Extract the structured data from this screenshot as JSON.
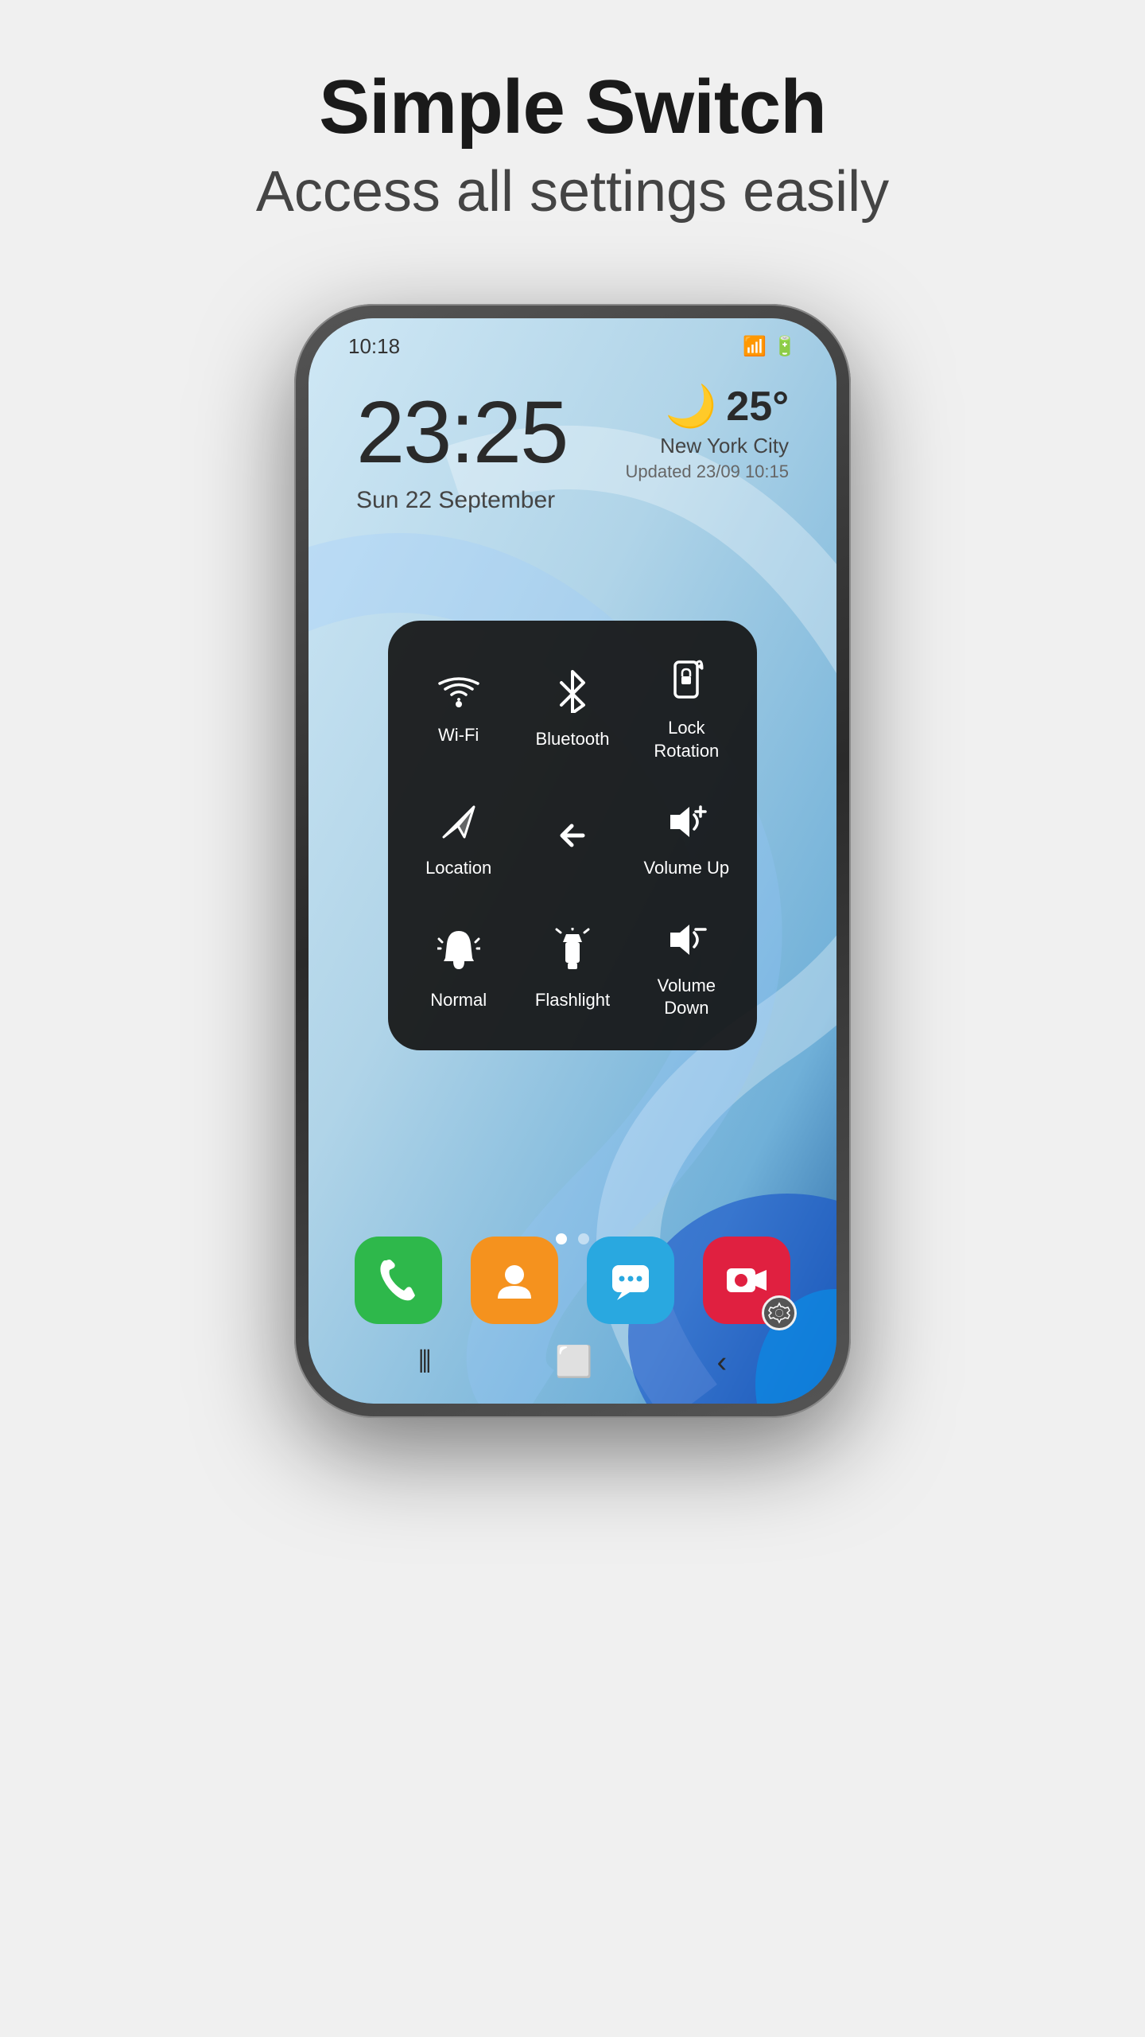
{
  "header": {
    "title": "Simple Switch",
    "subtitle": "Access all settings easily"
  },
  "phone": {
    "status_time": "10:18",
    "main_clock": "23:25",
    "main_date": "Sun 22 September",
    "weather": {
      "temp": "25°",
      "city": "New York City",
      "updated": "Updated 23/09 10:15",
      "moon_icon": "🌙"
    },
    "quick_controls": [
      {
        "id": "wifi",
        "label": "Wi-Fi",
        "icon": "wifi"
      },
      {
        "id": "bluetooth",
        "label": "Bluetooth",
        "icon": "bluetooth"
      },
      {
        "id": "lock-rotation",
        "label": "Lock\nRotation",
        "icon": "lock-rotation"
      },
      {
        "id": "location",
        "label": "Location",
        "icon": "location"
      },
      {
        "id": "back-arrow",
        "label": "",
        "icon": "back-arrow"
      },
      {
        "id": "volume-up",
        "label": "Volume Up",
        "icon": "volume-up"
      },
      {
        "id": "normal",
        "label": "Normal",
        "icon": "normal-bell"
      },
      {
        "id": "flashlight",
        "label": "Flashlight",
        "icon": "flashlight"
      },
      {
        "id": "volume-down",
        "label": "Volume\nDown",
        "icon": "volume-down"
      }
    ],
    "dock_apps": [
      {
        "id": "phone",
        "label": "Phone",
        "type": "phone"
      },
      {
        "id": "contacts",
        "label": "Contacts",
        "type": "contacts"
      },
      {
        "id": "messages",
        "label": "Messages",
        "type": "messages"
      },
      {
        "id": "app-settings",
        "label": "App Settings",
        "type": "settings-overlay"
      }
    ],
    "nav_dots": [
      "active",
      "inactive"
    ],
    "bottom_nav": [
      "|||",
      "○",
      "<"
    ]
  }
}
